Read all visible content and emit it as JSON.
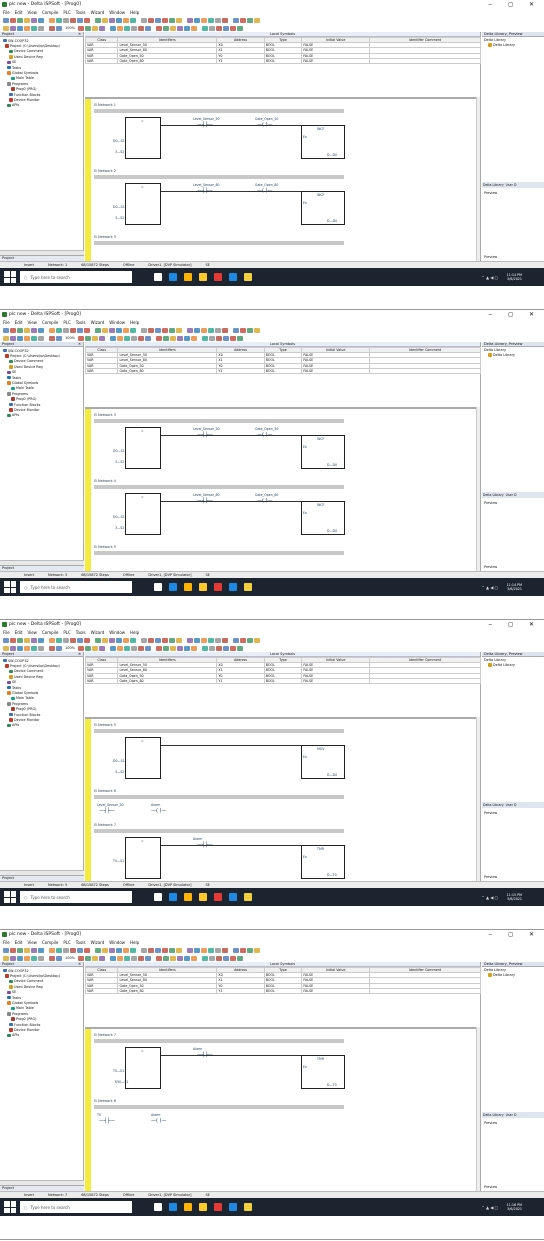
{
  "window_title": "plc new - Delta ISPSoft - [Prog0]",
  "menu": [
    "File",
    "Edit",
    "View",
    "Compile",
    "PLC",
    "Tools",
    "Wizard",
    "Window",
    "Help"
  ],
  "zoom": "100%",
  "project_panel": {
    "title": "Project",
    "items": [
      "SW-COOP32",
      "Project (C:\\Users\\kp\\Desktop)",
      "Device Comment",
      "Used Device Reg",
      "SE",
      "Tasks",
      "Global Symbols",
      "Main Table",
      "Programs",
      "Prog0 (PRG)",
      "Function Blocks",
      "Device Monitor",
      "APIs"
    ],
    "tab": "Project"
  },
  "local_symbols": {
    "title": "Local Symbols",
    "headers": [
      "Class",
      "Identifiers",
      "Address",
      "Type",
      "Initial Value",
      "Identifier Comment"
    ],
    "rows": [
      [
        "VAR",
        "Level_Sensor_50",
        "X0",
        "BOOL",
        "FALSE",
        ""
      ],
      [
        "VAR",
        "Level_Sensor_80",
        "X1",
        "BOOL",
        "FALSE",
        ""
      ],
      [
        "VAR",
        "Gate_Open_50",
        "Y0",
        "BOOL",
        "FALSE",
        ""
      ],
      [
        "VAR",
        "Gate_Open_80",
        "Y1",
        "BOOL",
        "FALSE",
        ""
      ]
    ]
  },
  "right_panel": {
    "title": "Delta Library, Preview",
    "sub": "Delta Library",
    "item": "Delta Library",
    "tab1": "Delta Library",
    "tab2": "User D",
    "preview": "Preview"
  },
  "status": {
    "mode": "Insert",
    "steps": "68/15872 Steps",
    "offline": "Offline",
    "driver": "Driver1, [DVP Simulator]",
    "se": "SE"
  },
  "taskbar": {
    "search": "Type here to search"
  },
  "shots": [
    {
      "network_status": "Network: 1",
      "time": "11:14 PM",
      "date": "5/6/2021",
      "networks": [
        {
          "label": "Network 1",
          "contact": "Level_Sensor_50",
          "coil": "Gate_Open_50",
          "fb": "INCF",
          "in1": "D0",
          "in2": "3"
        },
        {
          "label": "Network 2",
          "contact": "Level_Sensor_80",
          "coil": "Gate_Open_80",
          "fb": "INCF",
          "in1": "D0",
          "in2": "3"
        },
        {
          "label": "Network 3"
        }
      ]
    },
    {
      "network_status": "Network: 3",
      "time": "11:14 PM",
      "date": "5/6/2021",
      "networks": [
        {
          "label": "Network 3",
          "contact": "Level_Sensor_50",
          "coil": "Gate_Open_50",
          "fb": "INCF",
          "in1": "D0",
          "in2": "3"
        },
        {
          "label": "Network 4",
          "contact": "Level_Sensor_80",
          "coil": "Gate_Open_80",
          "fb": "INCF",
          "in1": "D0",
          "in2": "3"
        },
        {
          "label": "Network 5"
        }
      ]
    },
    {
      "network_status": "Network: 5",
      "time": "11:15 PM",
      "date": "5/6/2021",
      "networks": [
        {
          "label": "Network 5",
          "contact": "",
          "coil": "",
          "fb": "MOV",
          "in1": "D0",
          "in2": "3"
        },
        {
          "label": "Network 6",
          "contact": "Level_Sensor_50",
          "coil": "Alarm",
          "fb": "",
          "in1": "",
          "in2": ""
        },
        {
          "label": "Network 7",
          "contact": "Alarm",
          "coil": "",
          "fb": "TMR",
          "in1": "T0",
          "in2": ""
        }
      ]
    },
    {
      "network_status": "Network: 7",
      "time": "11:16 PM",
      "date": "5/6/2021",
      "networks": [
        {
          "label": "Network 7",
          "contact": "Alarm",
          "coil": "",
          "fb": "TMR",
          "in1": "T0",
          "in2": "K50"
        },
        {
          "label": "Network 8",
          "contact": "T0",
          "coil": "Alarm",
          "fb": "",
          "in1": "",
          "in2": ""
        }
      ]
    }
  ]
}
